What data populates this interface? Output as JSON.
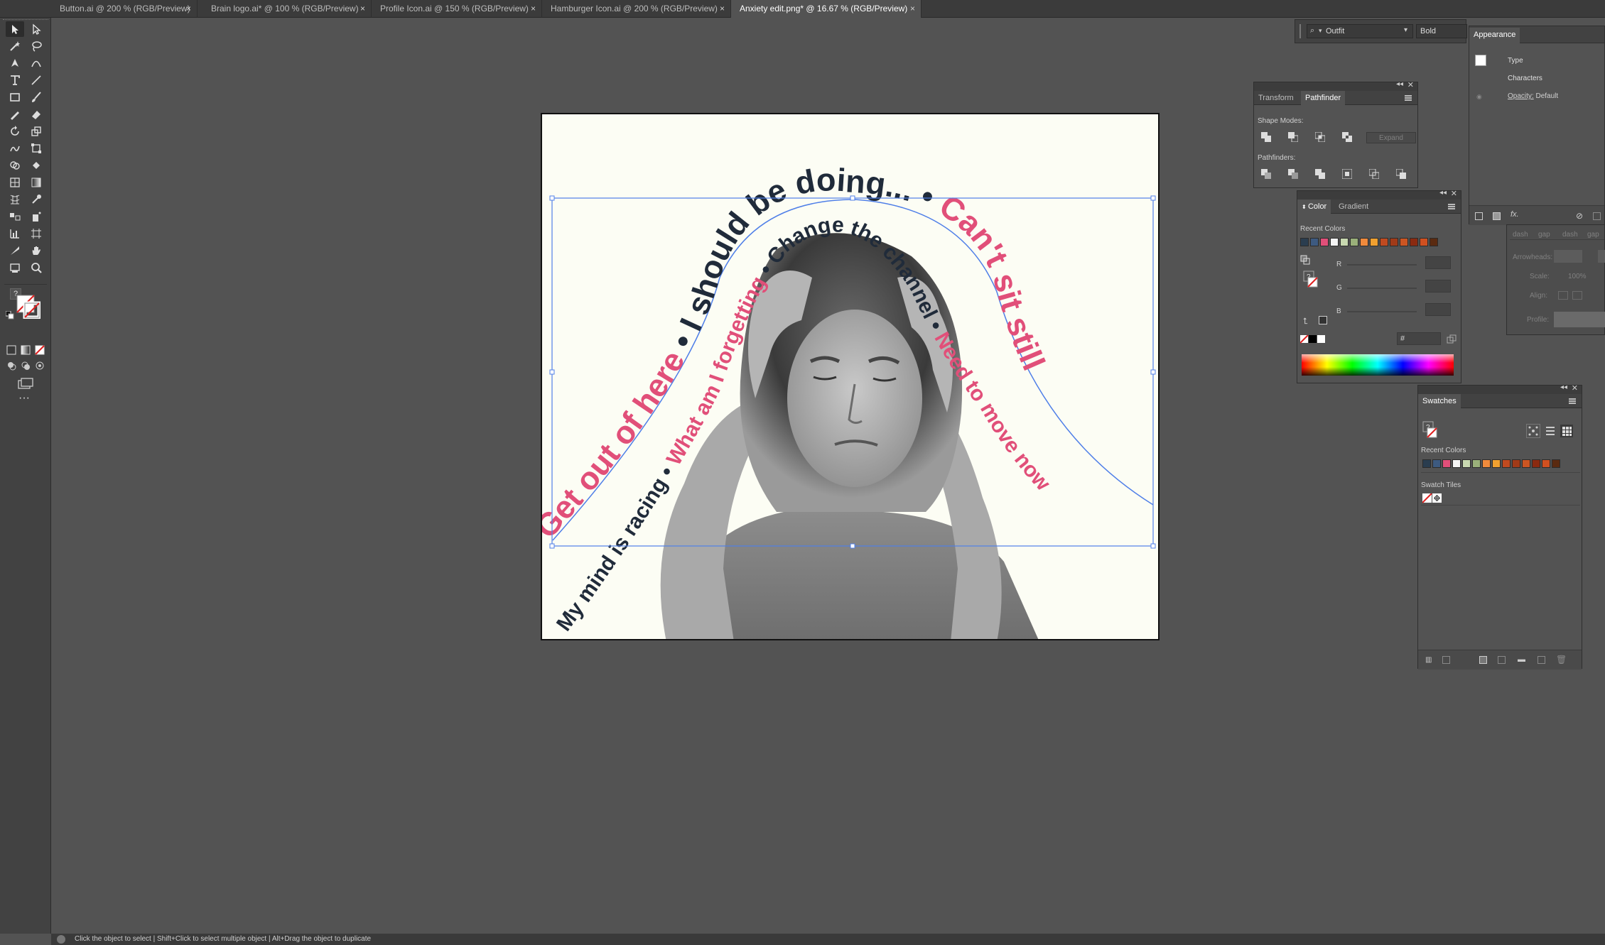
{
  "tabs": [
    {
      "label": "Button.ai @ 200 % (RGB/Preview)",
      "close": "×"
    },
    {
      "label": "Brain logo.ai* @ 100 % (RGB/Preview)",
      "close": "×"
    },
    {
      "label": "Profile Icon.ai @ 150 % (RGB/Preview)",
      "close": "×"
    },
    {
      "label": "Hamburger Icon.ai @ 200 % (RGB/Preview)",
      "close": "×"
    },
    {
      "label": "Anxiety edit.png* @ 16.67 % (RGB/Preview)",
      "close": "×"
    }
  ],
  "control_bar": {
    "font_family": "Outfit",
    "font_style": "Bold"
  },
  "artwork": {
    "texts": {
      "outer_1": "Get out of here",
      "outer_2": "I should be doing...",
      "outer_3": "Can't sit still",
      "inner_1": "My mind is racing",
      "inner_2": "What am I forgetting",
      "inner_3": "Change the channel",
      "inner_4": "Need to move now"
    },
    "colors": {
      "pink": "#e14f79",
      "navy": "#202b3a",
      "paper": "#fcfdf4",
      "selection": "#4f7fe8"
    }
  },
  "transform_panel": {
    "tab_transform": "Transform",
    "tab_pathfinder": "Pathfinder",
    "shape_modes": "Shape Modes:",
    "expand": "Expand",
    "pathfinders": "Pathfinders:"
  },
  "color_panel": {
    "tab_color": "Color",
    "tab_gradient": "Gradient",
    "recent": "Recent Colors",
    "r": "R",
    "g": "G",
    "b": "B",
    "hash": "#",
    "recent_colors": [
      "#2a3d4f",
      "#3d5a80",
      "#e14f79",
      "#f4f4f4",
      "#c8d8b0",
      "#9ab07a",
      "#f08a3c",
      "#f0a030",
      "#c04a20",
      "#a03a18",
      "#cc5522",
      "#8a2a10",
      "#d05020",
      "#5a2a10"
    ]
  },
  "appearance_panel": {
    "title": "Appearance",
    "type": "Type",
    "characters": "Characters",
    "opacity_label": "Opacity:",
    "opacity_value": "Default",
    "fx": "fx."
  },
  "stroke_panel": {
    "dash": "dash",
    "gap": "gap",
    "arrowheads": "Arrowheads:",
    "scale": "Scale:",
    "scale_value": "100%",
    "align": "Align:",
    "profile": "Profile:"
  },
  "swatches_panel": {
    "title": "Swatches",
    "recent": "Recent Colors",
    "tiles": "Swatch Tiles",
    "recent_colors": [
      "#2a3d4f",
      "#3d5a80",
      "#e14f79",
      "#f4f4f4",
      "#c8d8b0",
      "#9ab07a",
      "#f08a3c",
      "#f0a030",
      "#c04a20",
      "#a03a18",
      "#cc5522",
      "#8a2a10",
      "#d05020",
      "#5a2a10"
    ]
  },
  "statusbar": {
    "hint": "Click the object to select  |  Shift+Click to select multiple object  |  Alt+Drag the object to duplicate"
  }
}
